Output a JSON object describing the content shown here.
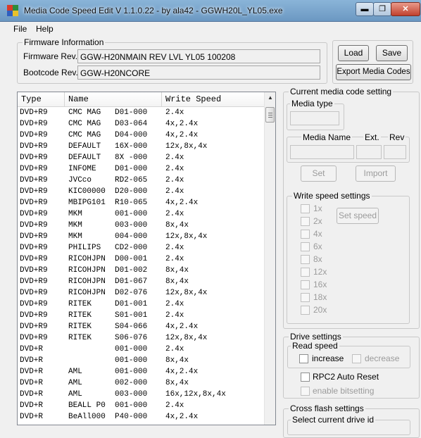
{
  "window": {
    "title": "Media Code Speed Edit V 1.1.0.22 - by ala42 - GGWH20L_YL05.exe",
    "min_glyph": "▬",
    "max_glyph": "❐",
    "close_glyph": "✕"
  },
  "menu": {
    "file": "File",
    "help": "Help"
  },
  "firmware": {
    "group_label": "Firmware Information",
    "fw_label": "Firmware Rev.",
    "fw_value": "GGW-H20NMAIN    REV LVL YL05 100208",
    "boot_label": "Bootcode Rev.",
    "boot_value": "GGW-H20NCORE"
  },
  "buttons": {
    "load": "Load",
    "save": "Save",
    "export": "Export Media Codes",
    "set": "Set",
    "import": "Import",
    "set_speed": "Set speed"
  },
  "list": {
    "columns": [
      "Type",
      "Name",
      "Write Speed"
    ],
    "rows": [
      [
        "DVD+R9",
        "CMC MAG   D01-000",
        "2.4x"
      ],
      [
        "DVD+R9",
        "CMC MAG   D03-064",
        "4x,2.4x"
      ],
      [
        "DVD+R9",
        "CMC MAG   D04-000",
        "4x,2.4x"
      ],
      [
        "DVD+R9",
        "DEFAULT   16X-000",
        "12x,8x,4x"
      ],
      [
        "DVD+R9",
        "DEFAULT   8X -000",
        "2.4x"
      ],
      [
        "DVD+R9",
        "INFOME    D01-000",
        "2.4x"
      ],
      [
        "DVD+R9",
        "JVCco     RD2-065",
        "2.4x"
      ],
      [
        "DVD+R9",
        "KIC00000  D20-000",
        "2.4x"
      ],
      [
        "DVD+R9",
        "MBIPG101  R10-065",
        "4x,2.4x"
      ],
      [
        "DVD+R9",
        "MKM       001-000",
        "2.4x"
      ],
      [
        "DVD+R9",
        "MKM       003-000",
        "8x,4x"
      ],
      [
        "DVD+R9",
        "MKM       004-000",
        "12x,8x,4x"
      ],
      [
        "DVD+R9",
        "PHILIPS   CD2-000",
        "2.4x"
      ],
      [
        "DVD+R9",
        "RICOHJPN  D00-001",
        "2.4x"
      ],
      [
        "DVD+R9",
        "RICOHJPN  D01-002",
        "8x,4x"
      ],
      [
        "DVD+R9",
        "RICOHJPN  D01-067",
        "8x,4x"
      ],
      [
        "DVD+R9",
        "RICOHJPN  D02-076",
        "12x,8x,4x"
      ],
      [
        "DVD+R9",
        "RITEK     D01-001",
        "2.4x"
      ],
      [
        "DVD+R9",
        "RITEK     S01-001",
        "2.4x"
      ],
      [
        "DVD+R9",
        "RITEK     S04-066",
        "4x,2.4x"
      ],
      [
        "DVD+R9",
        "RITEK     S06-076",
        "12x,8x,4x"
      ],
      [
        "DVD+R",
        "          001-000",
        "2.4x"
      ],
      [
        "DVD+R",
        "          001-000",
        "8x,4x"
      ],
      [
        "DVD+R",
        "AML       001-000",
        "4x,2.4x"
      ],
      [
        "DVD+R",
        "AML       002-000",
        "8x,4x"
      ],
      [
        "DVD+R",
        "AML       003-000",
        "16x,12x,8x,4x"
      ],
      [
        "DVD+R",
        "BEALL P0  001-000",
        "2.4x"
      ],
      [
        "DVD+R",
        "BeAll000  P40-000",
        "4x,2.4x"
      ]
    ]
  },
  "media_setting": {
    "group_label": "Current media code setting",
    "media_type_label": "Media type",
    "media_name_label": "Media Name",
    "ext_label": "Ext.",
    "rev_label": "Rev"
  },
  "write_speed": {
    "group_label": "Write speed settings",
    "speeds": [
      "1x",
      "2x",
      "4x",
      "6x",
      "8x",
      "12x",
      "16x",
      "18x",
      "20x"
    ]
  },
  "drive": {
    "group_label": "Drive settings",
    "read_speed_label": "Read speed",
    "increase": "increase",
    "decrease": "decrease",
    "rpc2": "RPC2 Auto Reset",
    "bitsetting": "enable bitsetting"
  },
  "cross_flash": {
    "group_label": "Cross flash settings",
    "select_drive_label": "Select current drive id"
  }
}
